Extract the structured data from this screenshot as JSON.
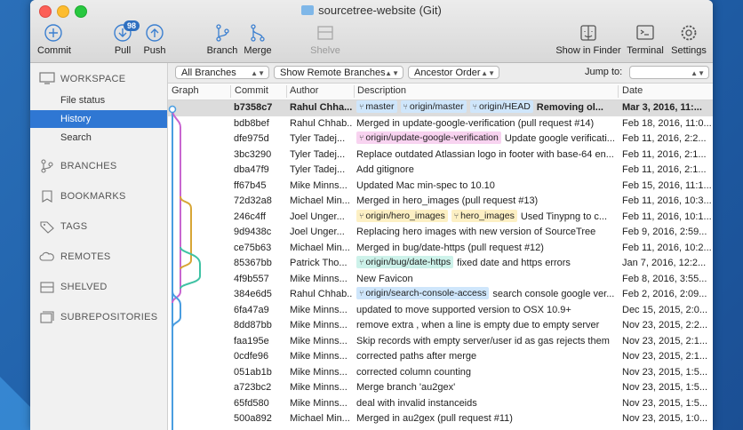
{
  "window": {
    "title": "sourcetree-website (Git)"
  },
  "toolbar": {
    "commit": "Commit",
    "pull": "Pull",
    "pull_badge": "98",
    "push": "Push",
    "branch": "Branch",
    "merge": "Merge",
    "shelve": "Shelve",
    "show_in_finder": "Show in Finder",
    "terminal": "Terminal",
    "settings": "Settings"
  },
  "sidebar": {
    "workspace": "WORKSPACE",
    "items": [
      "File status",
      "History",
      "Search"
    ],
    "selected": "History",
    "sections": [
      "BRANCHES",
      "BOOKMARKS",
      "TAGS",
      "REMOTES",
      "SHELVED",
      "SUBREPOSITORIES"
    ]
  },
  "filters": {
    "branches": "All Branches",
    "remote": "Show Remote Branches",
    "order": "Ancestor Order",
    "jump_to": "Jump to:"
  },
  "columns": {
    "graph": "Graph",
    "commit": "Commit",
    "author": "Author",
    "description": "Description",
    "date": "Date"
  },
  "colors": {
    "selection": "#2f77d3",
    "tag_blue": "#cfe6fb",
    "tag_pink": "#f8d3f0",
    "tag_yellow": "#fdf0c4",
    "tag_teal": "#cdf2ea"
  },
  "commits": [
    {
      "hash": "b7358c7",
      "author": "Rahul Chha...",
      "tags": [
        {
          "label": "master",
          "color": "#cfe6fb"
        },
        {
          "label": "origin/master",
          "color": "#cfe6fb"
        },
        {
          "label": "origin/HEAD",
          "color": "#cfe6fb"
        }
      ],
      "desc": "Removing ol...",
      "date": "Mar 3, 2016, 11:..."
    },
    {
      "hash": "bdb8bef",
      "author": "Rahul Chhab...",
      "tags": [],
      "desc": "Merged in update-google-verification (pull request #14)",
      "date": "Feb 18, 2016, 11:0..."
    },
    {
      "hash": "dfe975d",
      "author": "Tyler Tadej...",
      "tags": [
        {
          "label": "origin/update-google-verification",
          "color": "#f8d3f0"
        }
      ],
      "desc": "Update google verificati...",
      "date": "Feb 11, 2016, 2:2..."
    },
    {
      "hash": "3bc3290",
      "author": "Tyler Tadej...",
      "tags": [],
      "desc": "Replace outdated Atlassian logo in footer with base-64 en...",
      "date": "Feb 11, 2016, 2:1..."
    },
    {
      "hash": "dba47f9",
      "author": "Tyler Tadej...",
      "tags": [],
      "desc": "Add gitignore",
      "date": "Feb 11, 2016, 2:1..."
    },
    {
      "hash": "ff67b45",
      "author": "Mike Minns...",
      "tags": [],
      "desc": "Updated Mac min-spec to 10.10",
      "date": "Feb 15, 2016, 11:1..."
    },
    {
      "hash": "72d32a8",
      "author": "Michael Min...",
      "tags": [],
      "desc": "Merged in hero_images (pull request #13)",
      "date": "Feb 11, 2016, 10:3..."
    },
    {
      "hash": "246c4ff",
      "author": "Joel Unger...",
      "tags": [
        {
          "label": "origin/hero_images",
          "color": "#fdf0c4"
        },
        {
          "label": "hero_images",
          "color": "#fdf0c4"
        }
      ],
      "desc": "Used Tinypng to c...",
      "date": "Feb 11, 2016, 10:1..."
    },
    {
      "hash": "9d9438c",
      "author": "Joel Unger...",
      "tags": [],
      "desc": "Replacing hero images with new version of SourceTree",
      "date": "Feb 9, 2016, 2:59..."
    },
    {
      "hash": "ce75b63",
      "author": "Michael Min...",
      "tags": [],
      "desc": "Merged in bug/date-https (pull request #12)",
      "date": "Feb 11, 2016, 10:2..."
    },
    {
      "hash": "85367bb",
      "author": "Patrick Tho...",
      "tags": [
        {
          "label": "origin/bug/date-https",
          "color": "#cdf2ea"
        }
      ],
      "desc": "fixed date and https errors",
      "date": "Jan 7, 2016, 12:2..."
    },
    {
      "hash": "4f9b557",
      "author": "Mike Minns...",
      "tags": [],
      "desc": "New Favicon",
      "date": "Feb 8, 2016, 3:55..."
    },
    {
      "hash": "384e6d5",
      "author": "Rahul Chhab...",
      "tags": [
        {
          "label": "origin/search-console-access",
          "color": "#cfe6fb"
        }
      ],
      "desc": "search console google ver...",
      "date": "Feb 2, 2016, 2:09..."
    },
    {
      "hash": "6fa47a9",
      "author": "Mike Minns...",
      "tags": [],
      "desc": "updated to move supported version to OSX 10.9+",
      "date": "Dec 15, 2015, 2:0..."
    },
    {
      "hash": "8dd87bb",
      "author": "Mike Minns...",
      "tags": [],
      "desc": "remove extra , when a line is empty due to empty server",
      "date": "Nov 23, 2015, 2:2..."
    },
    {
      "hash": "faa195e",
      "author": "Mike Minns...",
      "tags": [],
      "desc": "Skip records with empty server/user id as gas rejects them",
      "date": "Nov 23, 2015, 2:1..."
    },
    {
      "hash": "0cdfe96",
      "author": "Mike Minns...",
      "tags": [],
      "desc": "corrected paths after merge",
      "date": "Nov 23, 2015, 2:1..."
    },
    {
      "hash": "051ab1b",
      "author": "Mike Minns...",
      "tags": [],
      "desc": " corrected column counting",
      "date": "Nov 23, 2015, 1:5..."
    },
    {
      "hash": "a723bc2",
      "author": "Mike Minns...",
      "tags": [],
      "desc": "Merge branch 'au2gex'",
      "date": "Nov 23, 2015, 1:5..."
    },
    {
      "hash": "65fd580",
      "author": "Mike Minns...",
      "tags": [],
      "desc": "deal with invalid instanceids",
      "date": "Nov 23, 2015, 1:5..."
    },
    {
      "hash": "500a892",
      "author": "Michael Min...",
      "tags": [],
      "desc": "Merged in au2gex (pull request #11)",
      "date": "Nov 23, 2015, 1:0..."
    }
  ]
}
